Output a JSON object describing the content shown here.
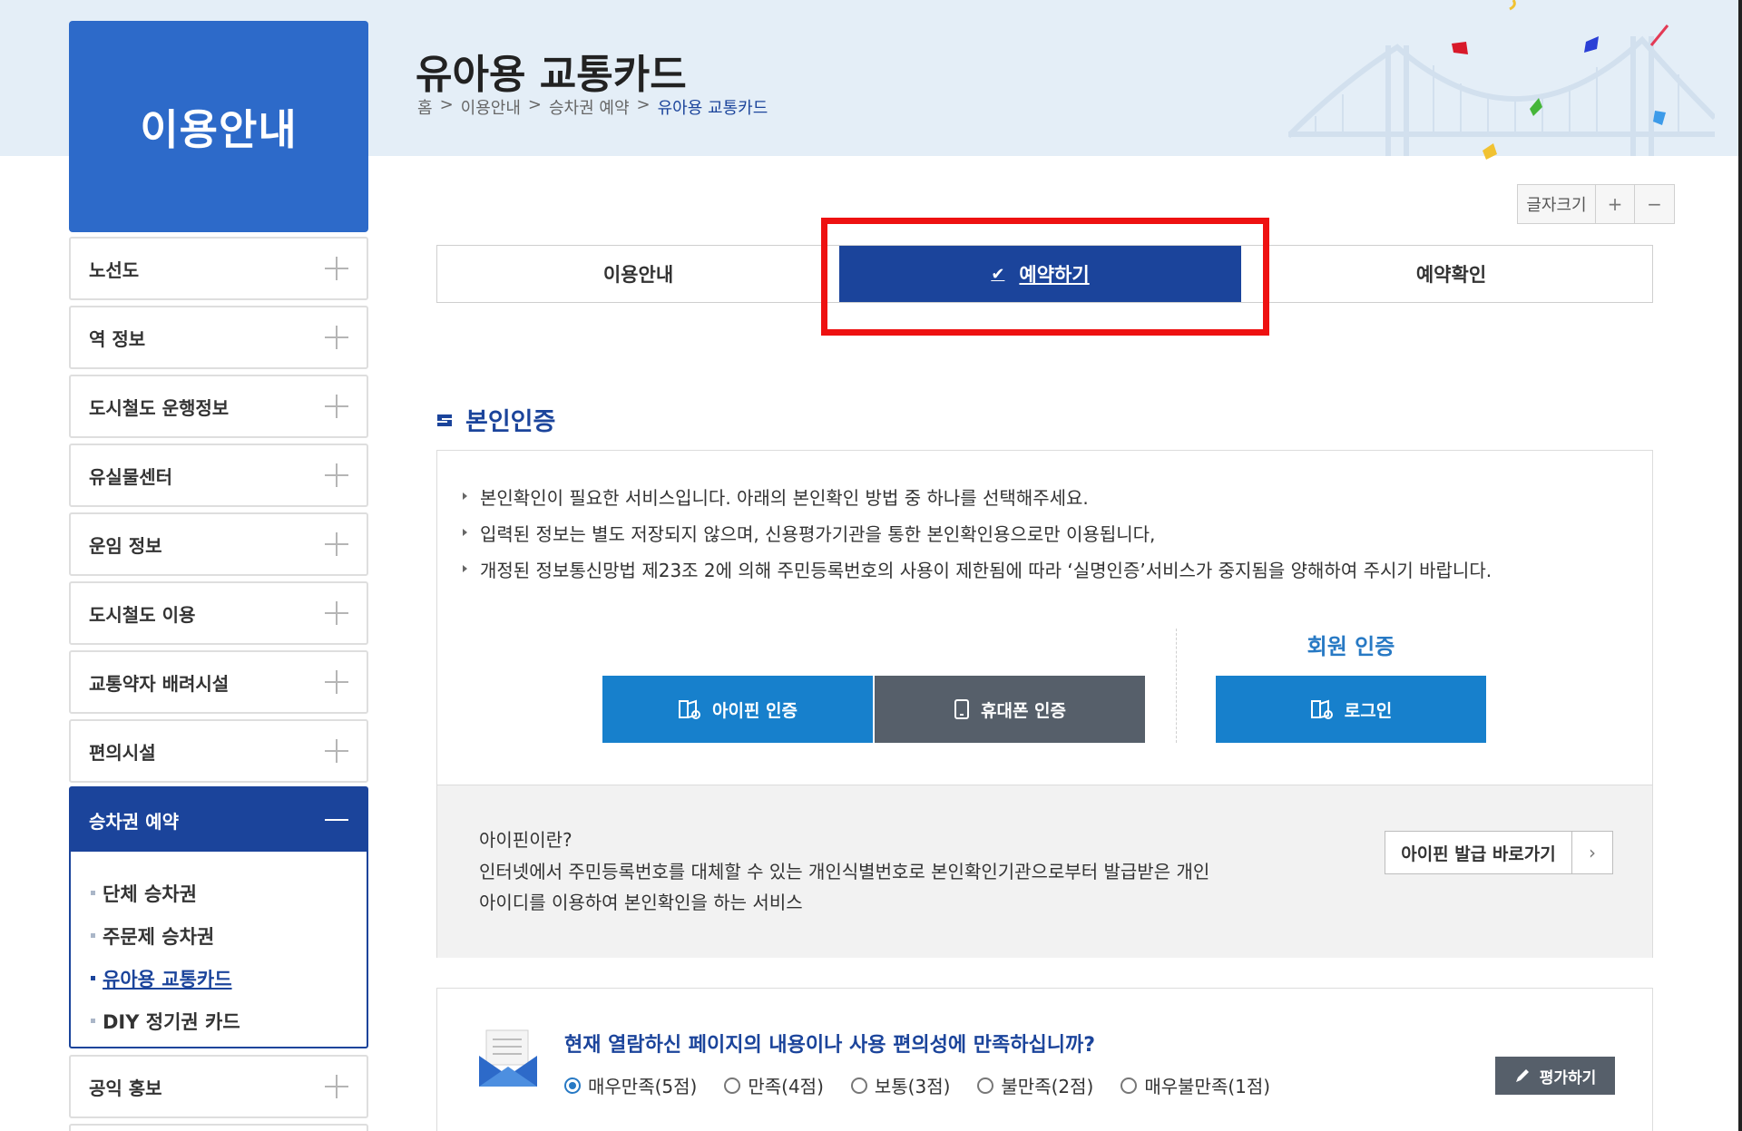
{
  "sidebar": {
    "title": "이용안내",
    "items": [
      {
        "label": "노선도"
      },
      {
        "label": "역 정보"
      },
      {
        "label": "도시철도 운행정보"
      },
      {
        "label": "유실물센터"
      },
      {
        "label": "운임 정보"
      },
      {
        "label": "도시철도 이용"
      },
      {
        "label": "교통약자 배려시설"
      },
      {
        "label": "편의시설"
      }
    ],
    "active": {
      "label": "승차권 예약",
      "subitems": [
        {
          "label": "단체 승차권"
        },
        {
          "label": "주문제 승차권"
        },
        {
          "label": "유아용 교통카드"
        },
        {
          "label": "DIY 정기권 카드"
        }
      ]
    },
    "after": [
      {
        "label": "공익 홍보"
      }
    ]
  },
  "header": {
    "title": "유아용 교통카드",
    "breadcrumb": [
      "홈",
      ">",
      "이용안내",
      ">",
      "승차권 예약",
      ">",
      "유아용 교통카드"
    ]
  },
  "font_control": {
    "label": "글자크기",
    "plus": "+",
    "minus": "−"
  },
  "tabs": [
    {
      "label": "이용안내"
    },
    {
      "label": "예약하기",
      "check": "✔"
    },
    {
      "label": "예약확인"
    }
  ],
  "auth": {
    "section_title": "본인인증",
    "notes": [
      "본인확인이 필요한 서비스입니다. 아래의 본인확인 방법 중 하나를 선택해주세요.",
      "입력된 정보는 별도 저장되지 않으며, 신용평가기관을 통한 본인확인용으로만 이용됩니다,",
      "개정된 정보통신망법 제23조 2에 의해 주민등록번호의 사용이 제한됨에 따라 ‘실명인증’서비스가 중지됨을 양해하여 주시기 바랍니다."
    ],
    "member_title": "회원 인증",
    "buttons": {
      "ipin": "아이핀 인증",
      "phone": "휴대폰 인증",
      "login": "로그인"
    },
    "ipin_question": "아이핀이란?",
    "ipin_desc_1": "인터넷에서 주민등록번호를 대체할 수 있는 개인식별번호로 본인확인기관으로부터 발급받은 개인",
    "ipin_desc_2": "아이디를 이용하여 본인확인을 하는 서비스",
    "ipin_link": "아이핀 발급 바로가기",
    "ipin_arrow": "›"
  },
  "survey": {
    "question": "현재 열람하신 페이지의 내용이나 사용 편의성에 만족하십니까?",
    "options": [
      "매우만족(5점)",
      "만족(4점)",
      "보통(3점)",
      "불만족(2점)",
      "매우불만족(1점)"
    ],
    "selected": "매우만족(5점)",
    "submit": "평가하기"
  },
  "colors": {
    "primary": "#1b449b",
    "accent": "#2d6ac9",
    "button_blue": "#1780cc",
    "button_gray": "#565f6a",
    "highlight": "#ee1111"
  }
}
